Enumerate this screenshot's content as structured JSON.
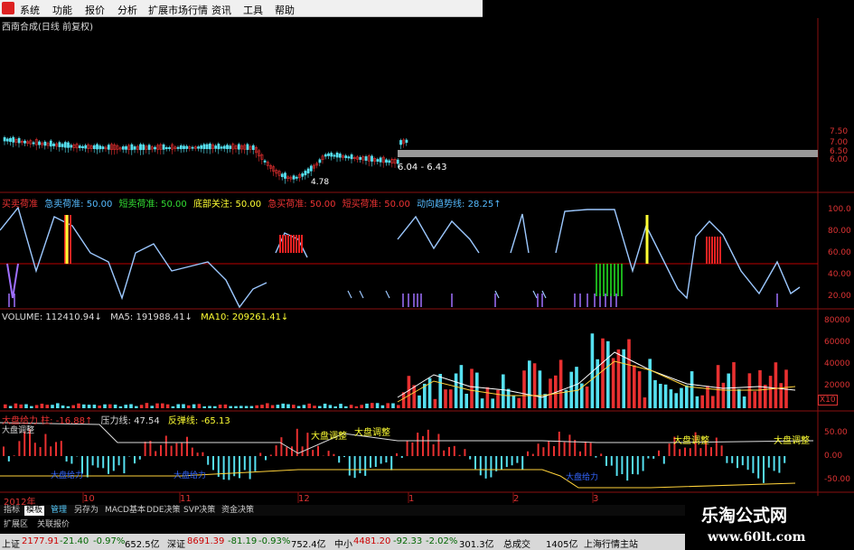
{
  "menu": [
    "系统",
    "功能",
    "报价",
    "分析",
    "扩展市场行情",
    "资讯",
    "工具",
    "帮助"
  ],
  "stock_title": "西南合成(日线 前复权)",
  "price_panel": {
    "y_ticks": [
      "7.50",
      "7.00",
      "6.50",
      "6.00"
    ],
    "range_label": "6.04 - 6.43",
    "low_label": "4.78"
  },
  "buy_sell_panel": {
    "labels": [
      {
        "text": "买卖荷准",
        "color": "#e33"
      },
      {
        "text": "急卖荷准: 50.00",
        "color": "#5bf"
      },
      {
        "text": "短卖荷准: 50.00",
        "color": "#3d3"
      },
      {
        "text": "底部关注: 50.00",
        "color": "#ff3"
      },
      {
        "text": "急买荷准: 50.00",
        "color": "#e33"
      },
      {
        "text": "短买荷准: 50.00",
        "color": "#e33"
      },
      {
        "text": "动向趋势线: 28.25↑",
        "color": "#5bf"
      }
    ],
    "y_ticks": [
      "100.0",
      "80.00",
      "60.00",
      "40.00",
      "20.00"
    ]
  },
  "volume_panel": {
    "labels": [
      {
        "text": "VOLUME: 112410.94↓",
        "color": "#ddd"
      },
      {
        "text": "MA5: 191988.41↓",
        "color": "#ddd"
      },
      {
        "text": "MA10: 209261.41↓",
        "color": "#ff3"
      }
    ],
    "y_ticks": [
      "80000",
      "60000",
      "40000",
      "20000"
    ],
    "unit": "X10"
  },
  "market_panel": {
    "labels": [
      {
        "text": "大盘给力 柱: -16.88↑",
        "color": "#e33"
      },
      {
        "text": "压力线: 47.54",
        "color": "#ddd"
      },
      {
        "text": "反弹线: -65.13",
        "color": "#ff3"
      }
    ],
    "y_ticks": [
      "50.00",
      "0.00",
      "-50.00"
    ],
    "annotations": [
      "大盘调整",
      "大盘调整",
      "大盘调整",
      "大盘调整",
      "大盘给力",
      "大盘给力",
      "大盘给力",
      "大盘给力",
      "大盘调整"
    ]
  },
  "x_axis": [
    "2012年",
    "10",
    "11",
    "12",
    "1",
    "2",
    "3"
  ],
  "tabs": [
    "指标",
    "模板",
    "管理",
    "另存为",
    "MACD基本",
    "DDE决策",
    "SVP决策",
    "资金决策"
  ],
  "tabs2": [
    "扩展区",
    "关联报价"
  ],
  "status": {
    "sh": "上证",
    "sh_val": "2177.91",
    "sh_chg": "-21.40",
    "sh_pct": "-0.97%",
    "sh_amt": "652.5亿",
    "sz": "深证",
    "sz_val": "8691.39",
    "sz_chg": "-81.19",
    "sz_pct": "-0.93%",
    "sz_amt": "752.4亿",
    "zx": "中小",
    "zx_val": "4481.20",
    "zx_chg": "-92.33",
    "zx_pct": "-2.02%",
    "zx_amt": "301.3亿",
    "total": "总成交",
    "total_val": "1405亿",
    "site": "上海行情主站"
  },
  "watermark": {
    "title": "乐淘公式网",
    "url": "www.60lt.com"
  },
  "colors": {
    "up": "#e83030",
    "down": "#55e0f0",
    "ma5": "#ffffff",
    "ma10": "#ffd23a",
    "red_axis": "#d33"
  }
}
